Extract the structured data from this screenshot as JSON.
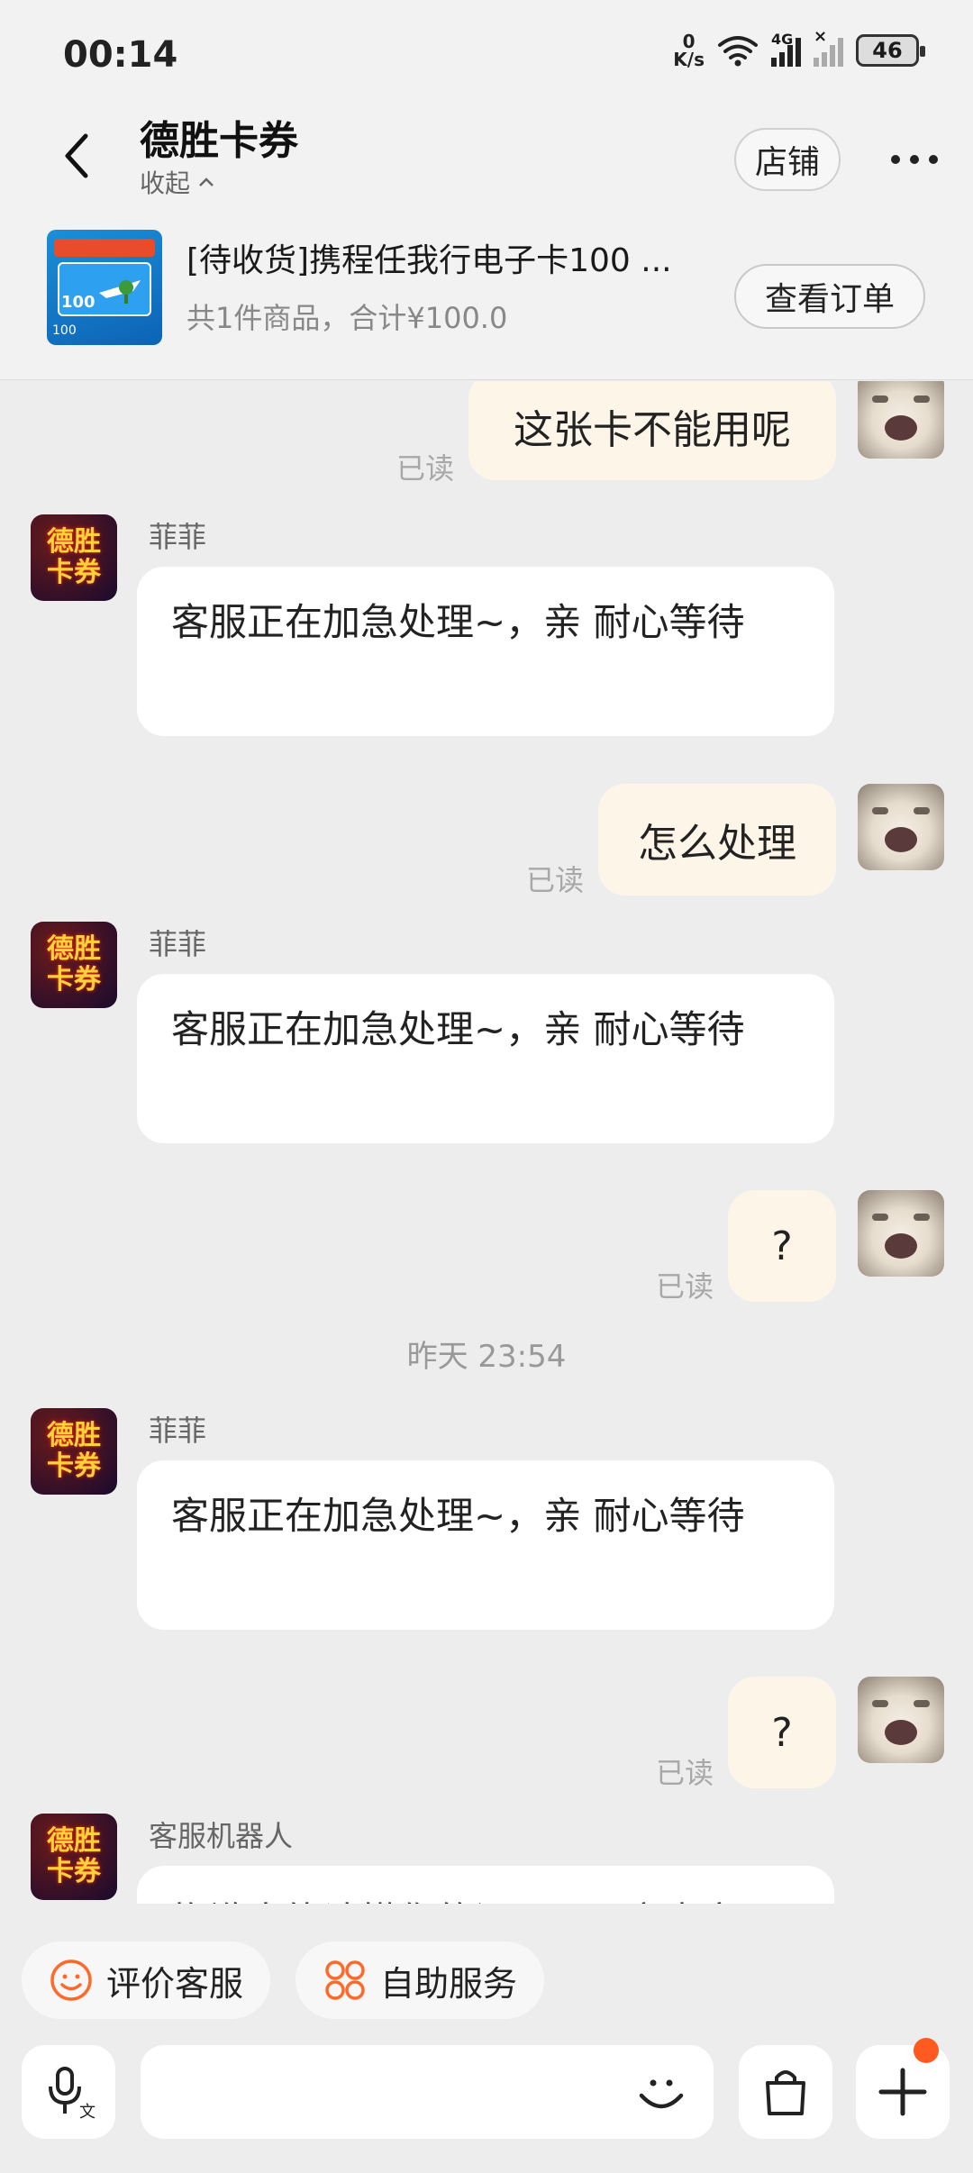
{
  "status": {
    "time": "00:14",
    "net_speed_value": "0",
    "net_speed_unit": "K/s",
    "network_type": "4G",
    "battery": "46"
  },
  "header": {
    "title": "德胜卡券",
    "collapse_label": "收起",
    "shop_button": "店铺"
  },
  "order": {
    "title": "[待收货]携程任我行电子卡100 ...",
    "summary": "共1件商品，合计¥100.0",
    "view_button": "查看订单",
    "thumb_face_value": "100",
    "thumb_small_value": "100"
  },
  "seller_avatar": {
    "line1": "德胜",
    "line2": "卡券"
  },
  "messages": [
    {
      "type": "out",
      "text": "这张卡不能用呢",
      "read": "已读"
    },
    {
      "type": "in",
      "sender": "菲菲",
      "text": "客服正在加急处理~，亲 耐心等待"
    },
    {
      "type": "out",
      "text": "怎么处理",
      "read": "已读"
    },
    {
      "type": "in",
      "sender": "菲菲",
      "text": "客服正在加急处理~，亲 耐心等待"
    },
    {
      "type": "out",
      "text": "?",
      "read": "已读"
    },
    {
      "type": "time",
      "text": "昨天  23:54"
    },
    {
      "type": "in",
      "sender": "菲菲",
      "text": "客服正在加急处理~，亲 耐心等待"
    },
    {
      "type": "out",
      "text": "?",
      "read": "已读"
    },
    {
      "type": "in",
      "sender": "客服机器人",
      "text": "抱歉未能读懂您的问题，用户内容"
    }
  ],
  "quick_actions": {
    "rate_service": "评价客服",
    "self_service": "自助服务"
  },
  "icons": {
    "back": "chevron-left-icon",
    "more": "more-dots-icon",
    "voice": "microphone-icon",
    "emoji": "smile-icon",
    "shop_bag": "shopping-bag-icon",
    "add": "plus-icon"
  },
  "colors": {
    "accent": "#ff5a1f",
    "bubble_out": "#fdf6e8",
    "bubble_in": "#ffffff",
    "background": "#ededed"
  }
}
